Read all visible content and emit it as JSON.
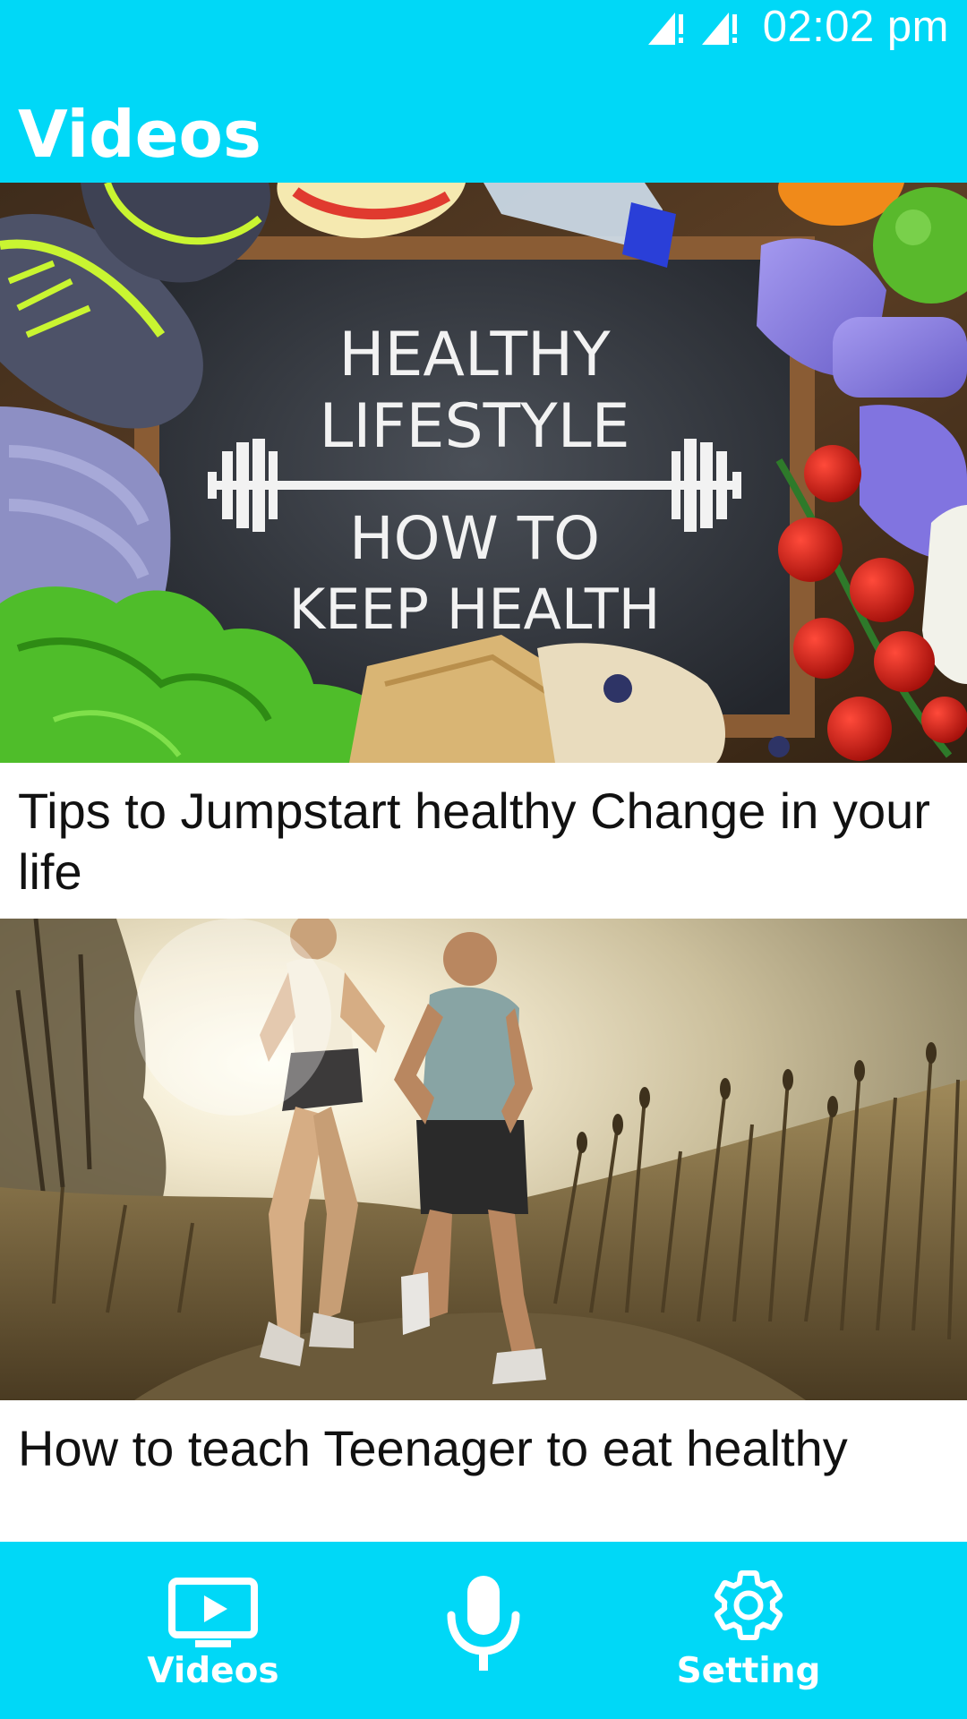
{
  "theme": {
    "accent": "#00d8f7",
    "text": "#111111"
  },
  "status_bar": {
    "time": "02:02 pm",
    "icons": [
      "signal-no-data-icon",
      "signal-no-data-icon"
    ]
  },
  "header": {
    "title": "Videos"
  },
  "videos": [
    {
      "title": "Tips to Jumpstart healthy Change in your life",
      "thumbnail": {
        "kind": "photo",
        "subject": "chalkboard surrounded by sneakers, measuring tape, water bottle, dumbbells, fruit, tomatoes, lettuce, towel and crackers",
        "chalk_text": {
          "line1": "HEALTHY",
          "line2": "LIFESTYLE",
          "line3": "HOW TO",
          "line4": "KEEP HEALTH"
        }
      }
    },
    {
      "title": "How to teach Teenager to eat healthy",
      "thumbnail": {
        "kind": "photo",
        "subject": "man and woman jogging on a trail through tall grass at sunset"
      }
    }
  ],
  "bottom_nav": {
    "items": [
      {
        "label": "Videos",
        "icon": "video-icon",
        "active": true
      },
      {
        "label": "",
        "icon": "microphone-icon",
        "active": false
      },
      {
        "label": "Setting",
        "icon": "gear-icon",
        "active": false
      }
    ]
  }
}
